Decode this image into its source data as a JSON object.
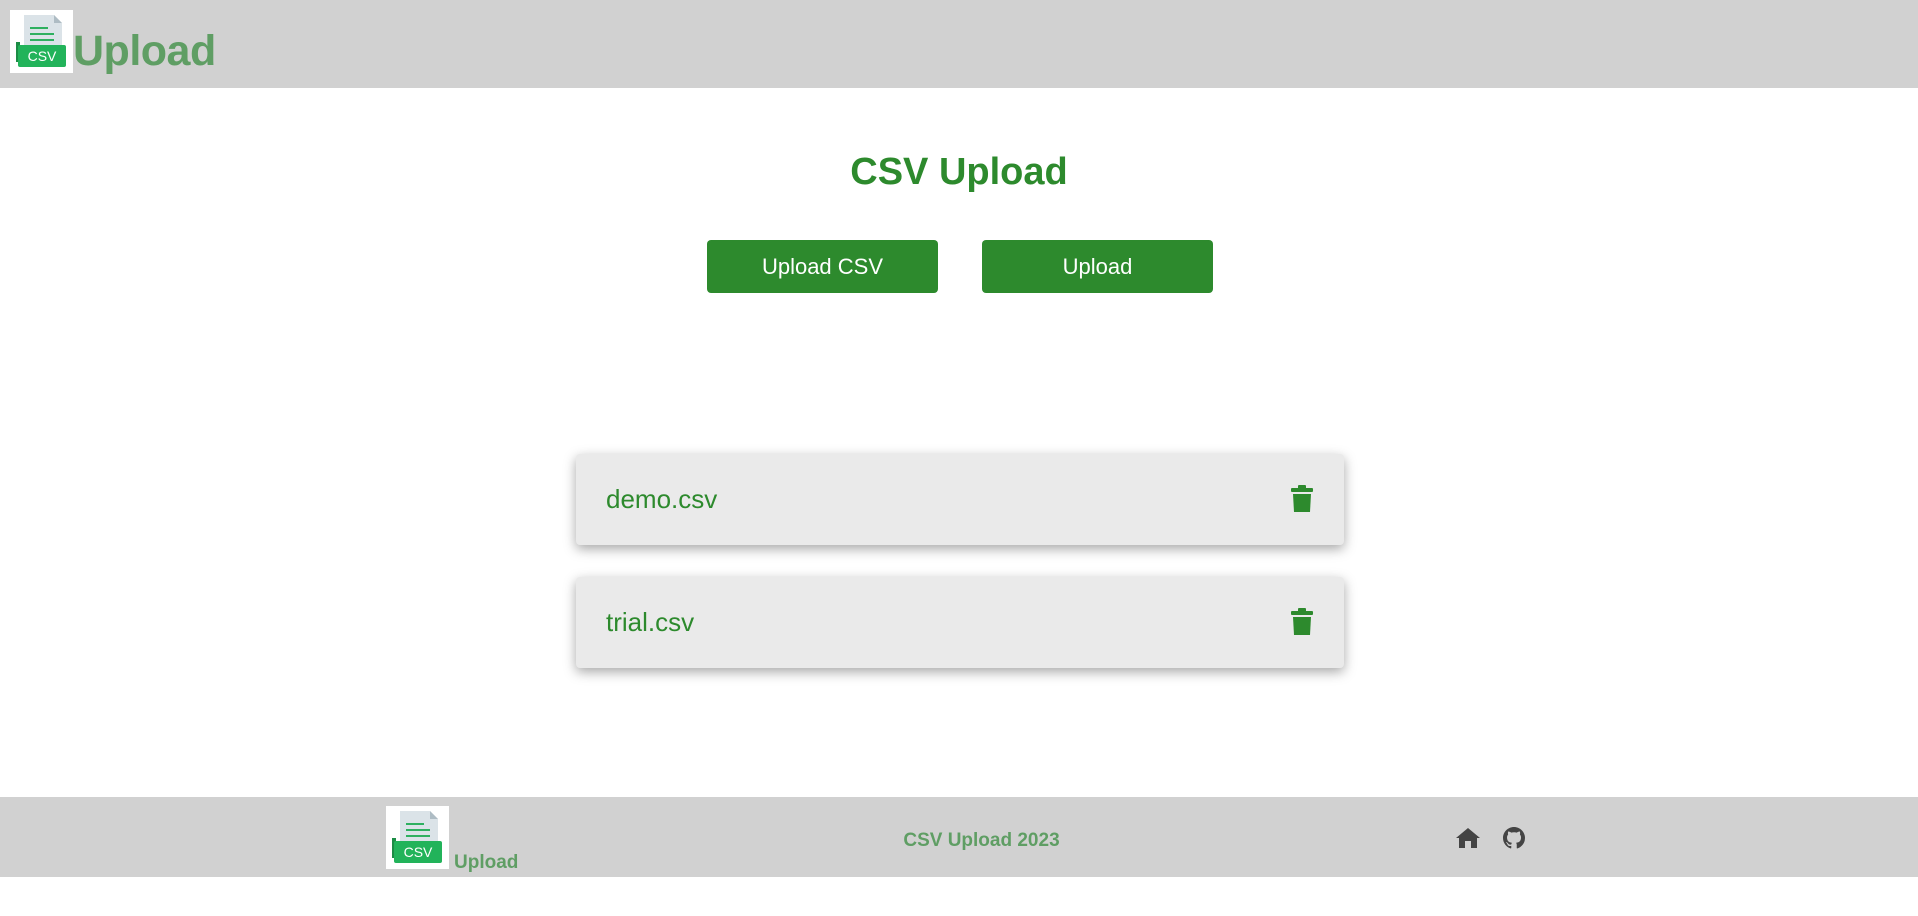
{
  "header": {
    "logo_text": "CSV",
    "title": "Upload"
  },
  "main": {
    "title": "CSV Upload",
    "select_button_label": "Upload CSV",
    "upload_button_label": "Upload",
    "files": [
      {
        "name": "demo.csv"
      },
      {
        "name": "trial.csv"
      }
    ]
  },
  "footer": {
    "logo_text": "CSV",
    "brand": "Upload",
    "copyright": "CSV Upload 2023"
  },
  "icons": {
    "logo": "csv-file-icon",
    "delete": "trash-icon",
    "home": "home-icon",
    "github": "github-icon"
  },
  "colors": {
    "accent": "#2d8a2d",
    "brand_text": "#5f9e64",
    "bar_background": "#d1d1d1",
    "card_background": "#eaeaea",
    "icon_dark": "#444444"
  }
}
